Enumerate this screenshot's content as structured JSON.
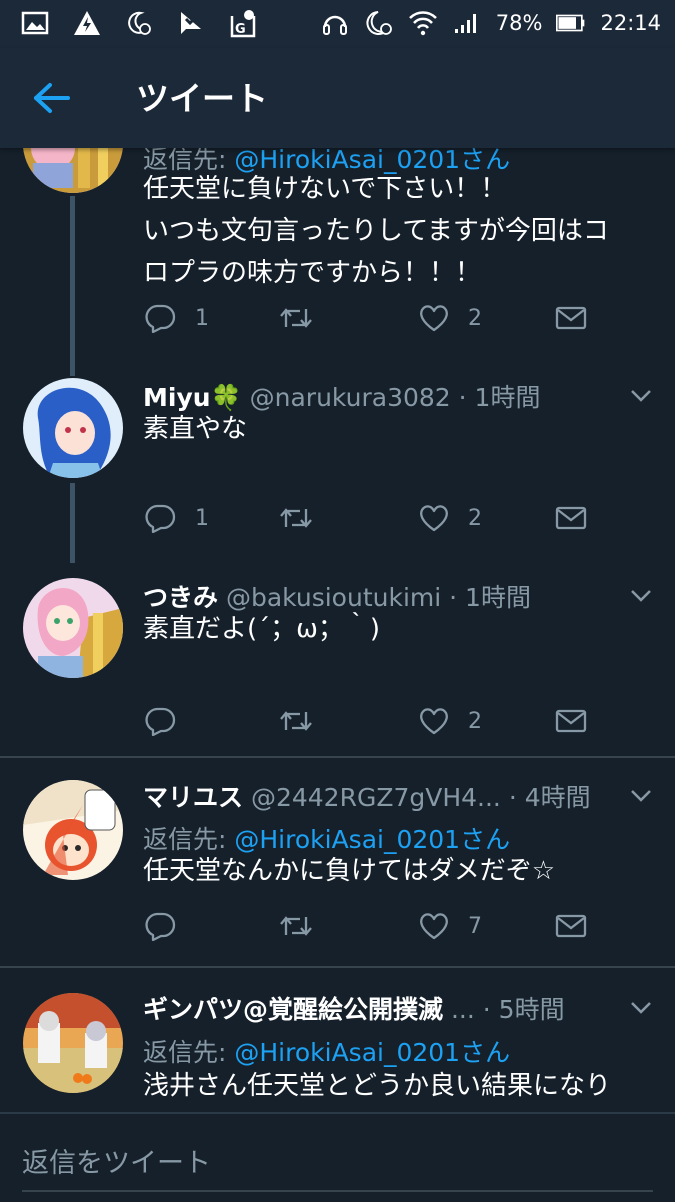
{
  "status_bar": {
    "left_icons": [
      "image-icon",
      "warning-icon",
      "moon-alarm-icon",
      "check-flag-icon",
      "map-g-icon"
    ],
    "battery": "78%",
    "time": "22:14"
  },
  "header": {
    "title": "ツイート"
  },
  "tweets": [
    {
      "reply_prefix": "返信先: ",
      "reply_mention": "@HirokiAsai_0201さん",
      "text": "任天堂に負けないで下さい！！\nいつも文句言ったりしてますが今回はコ\nロプラの味方ですから！！！",
      "replies": "1",
      "retweets": "",
      "likes": "2"
    },
    {
      "name": "Miyu🍀",
      "handle": "@narukura3082",
      "time": "· 1時間",
      "text": "素直やな",
      "replies": "1",
      "retweets": "",
      "likes": "2"
    },
    {
      "name": "つきみ",
      "handle": "@bakusioutukimi",
      "time": "· 1時間",
      "text": "素直だよ(´；ω；｀)",
      "replies": "",
      "retweets": "",
      "likes": "2"
    },
    {
      "name": "マリユス",
      "handle": "@2442RGZ7gVH4...",
      "time": "· 4時間",
      "reply_prefix": "返信先: ",
      "reply_mention": "@HirokiAsai_0201さん",
      "text": "任天堂なんかに負けてはダメだぞ☆",
      "replies": "",
      "retweets": "",
      "likes": "7"
    },
    {
      "name": "ギンパツ@覚醒絵公開撲滅",
      "handle": "...",
      "time": "· 5時間",
      "reply_prefix": "返信先: ",
      "reply_mention": "@HirokiAsai_0201さん",
      "text": "浅井さん任天堂とどうか良い結果になり"
    }
  ],
  "reply_bar": {
    "placeholder": "返信をツイート"
  },
  "colors": {
    "background": "#15202b",
    "header": "#1c2938",
    "accent": "#1da1f2",
    "secondary_text": "#8899a6",
    "divider": "#38444d"
  }
}
